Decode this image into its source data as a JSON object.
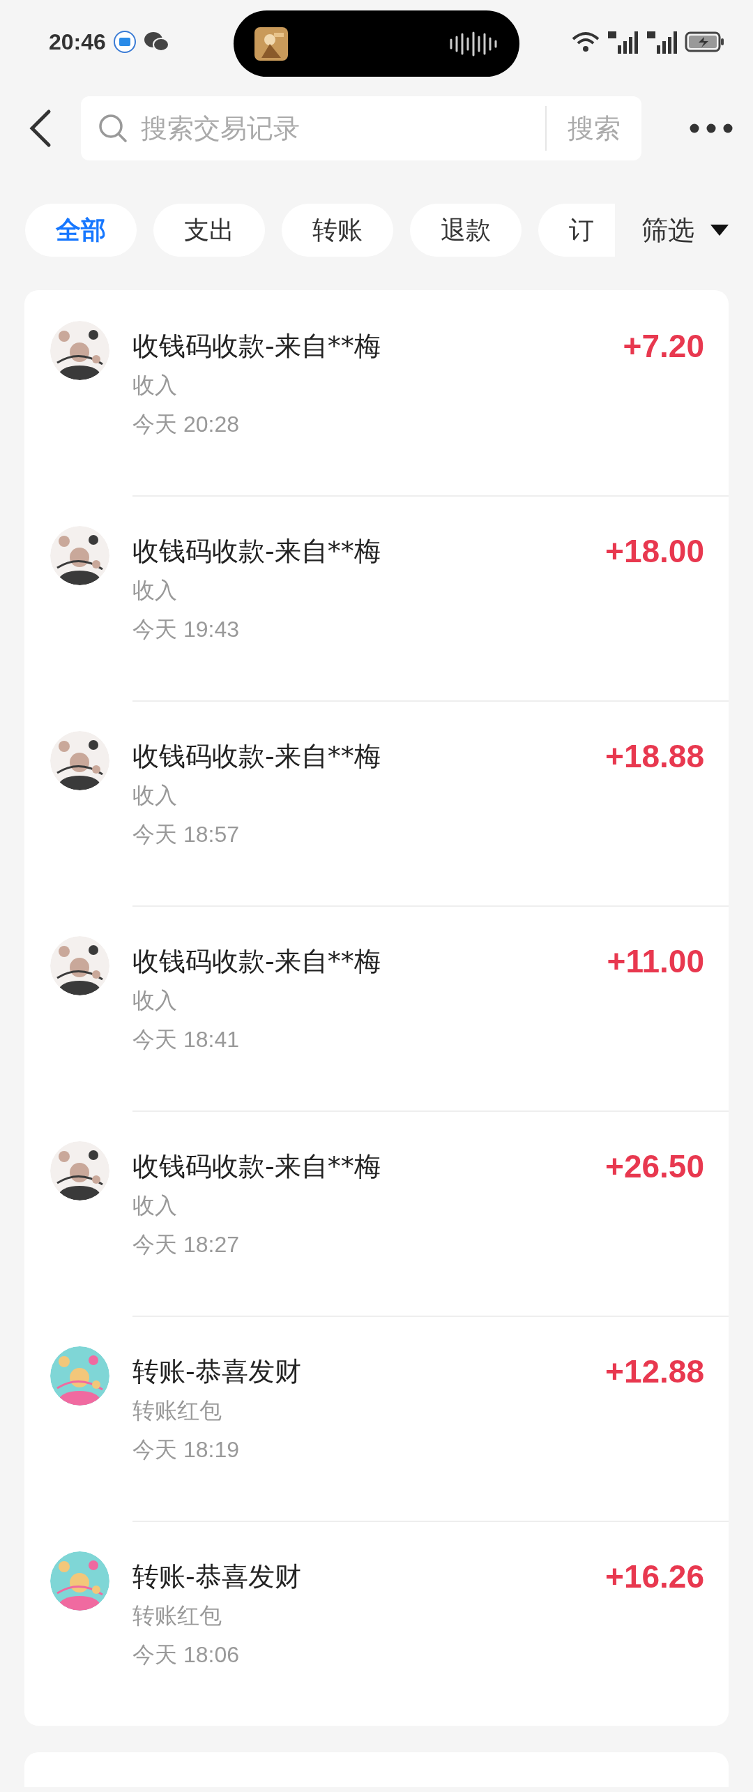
{
  "status_bar": {
    "time": "20:46"
  },
  "search": {
    "placeholder": "搜索交易记录",
    "button": "搜索"
  },
  "tabs": [
    {
      "label": "全部",
      "selected": true
    },
    {
      "label": "支出",
      "selected": false
    },
    {
      "label": "转账",
      "selected": false
    },
    {
      "label": "退款",
      "selected": false
    },
    {
      "label": "订",
      "selected": false
    }
  ],
  "filter": {
    "label": "筛选"
  },
  "transactions": [
    {
      "title": "收钱码收款-来自**梅",
      "category": "收入",
      "time": "今天 20:28",
      "amount": "+7.20"
    },
    {
      "title": "收钱码收款-来自**梅",
      "category": "收入",
      "time": "今天 19:43",
      "amount": "+18.00"
    },
    {
      "title": "收钱码收款-来自**梅",
      "category": "收入",
      "time": "今天 18:57",
      "amount": "+18.88"
    },
    {
      "title": "收钱码收款-来自**梅",
      "category": "收入",
      "time": "今天 18:41",
      "amount": "+11.00"
    },
    {
      "title": "收钱码收款-来自**梅",
      "category": "收入",
      "time": "今天 18:27",
      "amount": "+26.50"
    },
    {
      "title": "转账-恭喜发财",
      "category": "转账红包",
      "time": "今天 18:19",
      "amount": "+12.88"
    },
    {
      "title": "转账-恭喜发财",
      "category": "转账红包",
      "time": "今天 18:06",
      "amount": "+16.26"
    }
  ]
}
